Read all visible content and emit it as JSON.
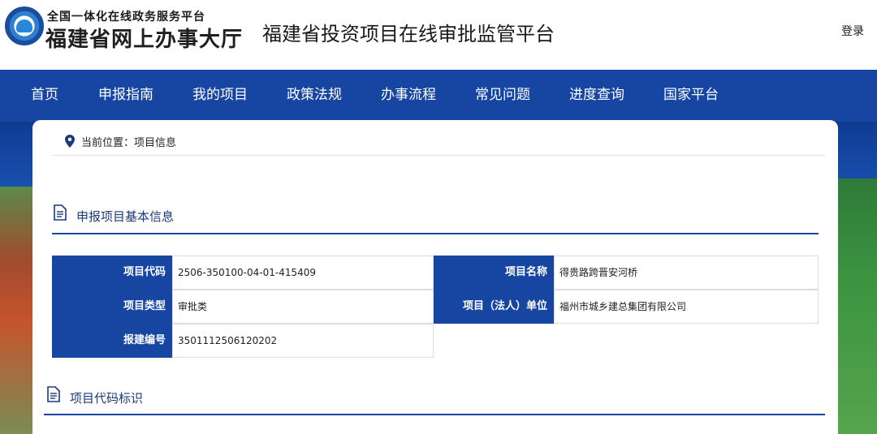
{
  "header": {
    "logo_top": "全国一体化在线政务服务平台",
    "logo_main": "福建省网上办事大厅",
    "platform_title": "福建省投资项目在线审批监管平台",
    "login": "登录"
  },
  "nav": {
    "items": [
      {
        "label": "首页"
      },
      {
        "label": "申报指南"
      },
      {
        "label": "我的项目"
      },
      {
        "label": "政策法规"
      },
      {
        "label": "办事流程"
      },
      {
        "label": "常见问题"
      },
      {
        "label": "进度查询"
      },
      {
        "label": "国家平台"
      }
    ]
  },
  "breadcrumb": {
    "icon": "location-pin-icon",
    "label": "当前位置：项目信息"
  },
  "basic_info": {
    "title": "申报项目基本信息",
    "icon": "document-icon",
    "fields": [
      {
        "label": "项目代码",
        "value": "2506-350100-04-01-415409"
      },
      {
        "label": "项目名称",
        "value": "得贵路跨晋安河桥"
      },
      {
        "label": "项目类型",
        "value": "审批类"
      },
      {
        "label": "项目（法人）单位",
        "value": "福州市城乡建总集团有限公司"
      },
      {
        "label": "报建编号",
        "value": "3501112506120202"
      }
    ]
  },
  "code_section": {
    "title": "项目代码标识",
    "icon": "document-icon"
  },
  "colors": {
    "nav_blue": "#1746a2",
    "label_blue": "#1746a2",
    "title_blue": "#1b3a7a"
  }
}
